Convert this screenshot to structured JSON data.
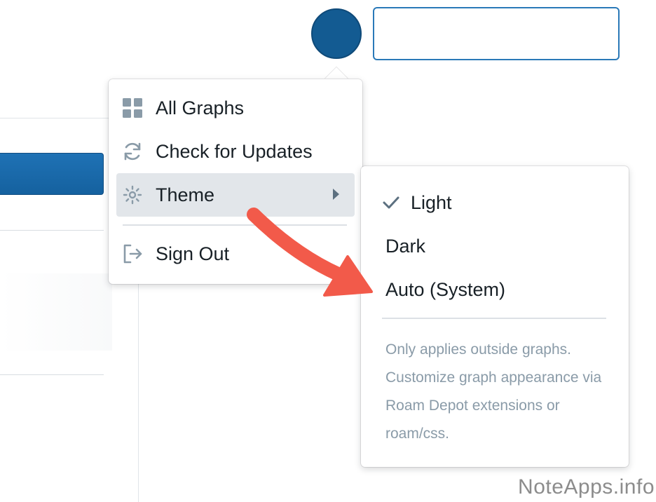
{
  "menu": {
    "items": [
      {
        "label": "All Graphs",
        "icon": "grid-icon"
      },
      {
        "label": "Check for Updates",
        "icon": "refresh-icon"
      },
      {
        "label": "Theme",
        "icon": "sun-icon",
        "active": true,
        "has_submenu": true
      },
      {
        "label": "Sign Out",
        "icon": "log-out-icon"
      }
    ]
  },
  "theme_submenu": {
    "options": [
      {
        "label": "Light",
        "selected": true
      },
      {
        "label": "Dark",
        "selected": false
      },
      {
        "label": "Auto (System)",
        "selected": false
      }
    ],
    "note": "Only applies outside graphs. Customize graph appearance via Roam Depot extensions or roam/css."
  },
  "colors": {
    "accent": "#135b92",
    "annotation_arrow": "#f25a4a",
    "hover_bg": "#e2e6ea",
    "muted_text": "#8a9ba8"
  },
  "watermark": "NoteApps.info"
}
